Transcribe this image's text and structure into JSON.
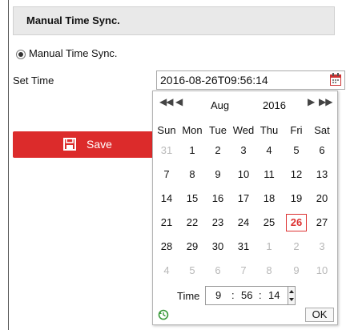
{
  "section": {
    "title": "Manual Time Sync."
  },
  "option": {
    "label": "Manual Time Sync."
  },
  "set_time": {
    "label": "Set Time",
    "value": "2016-08-26T09:56:14"
  },
  "save": {
    "label": "Save"
  },
  "calendar": {
    "nav_prev_year": "◀◀",
    "nav_prev_month": "◀",
    "nav_next_month": "▶",
    "nav_next_year": "▶▶",
    "month": "Aug",
    "year": "2016",
    "weekdays": [
      "Sun",
      "Mon",
      "Tue",
      "Wed",
      "Thu",
      "Fri",
      "Sat"
    ],
    "weeks": [
      [
        "31",
        "1",
        "2",
        "3",
        "4",
        "5",
        "6"
      ],
      [
        "7",
        "8",
        "9",
        "10",
        "11",
        "12",
        "13"
      ],
      [
        "14",
        "15",
        "16",
        "17",
        "18",
        "19",
        "20"
      ],
      [
        "21",
        "22",
        "23",
        "24",
        "25",
        "26",
        "27"
      ],
      [
        "28",
        "29",
        "30",
        "31",
        "1",
        "2",
        "3"
      ],
      [
        "4",
        "5",
        "6",
        "7",
        "8",
        "9",
        "10"
      ]
    ],
    "selected_day": "26",
    "time_label": "Time",
    "hour": "9",
    "minute": "56",
    "second": "14",
    "sep": ":",
    "ok": "OK"
  },
  "colors": {
    "accent": "#dc2b2b",
    "selected": "#d33333",
    "other_month": "#b8b8b8"
  }
}
